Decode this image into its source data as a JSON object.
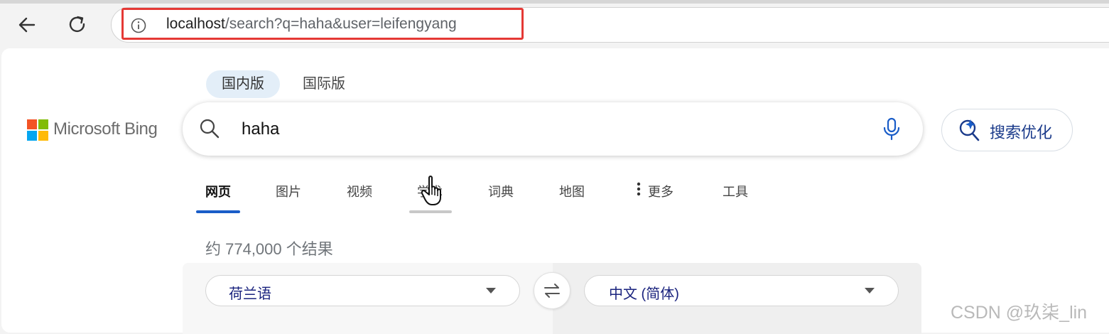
{
  "browser": {
    "url_host": "localhost",
    "url_rest": "/search?q=haha&user=leifengyang"
  },
  "region_tabs": {
    "domestic": "国内版",
    "international": "国际版"
  },
  "brand": {
    "name": "Microsoft Bing"
  },
  "search": {
    "query": "haha"
  },
  "optimize_button": {
    "label": "搜索优化"
  },
  "nav_tabs": {
    "web": "网页",
    "images": "图片",
    "videos": "视频",
    "academic": "学术",
    "dictionary": "词典",
    "maps": "地图",
    "more": "更多",
    "tools": "工具"
  },
  "results": {
    "count_text": "约 774,000 个结果"
  },
  "translator": {
    "source_lang": "荷兰语",
    "target_lang": "中文 (简体)"
  },
  "watermark": "CSDN @玖柒_lin",
  "colors": {
    "accent_underline": "#1a5dc8",
    "url_highlight": "#e53935",
    "logo_red": "#f35325",
    "logo_green": "#81bc06",
    "logo_blue": "#05a6f0",
    "logo_yellow": "#ffba08"
  },
  "icons": {
    "back": "back-arrow-icon",
    "reload": "reload-icon",
    "site_info": "info-icon",
    "search": "search-icon",
    "mic": "microphone-icon",
    "optimize": "search-optimize-icon",
    "more": "vertical-dots-icon",
    "swap": "swap-arrows-icon",
    "dropdown": "caret-down-icon",
    "cursor": "hand-pointer-icon"
  }
}
